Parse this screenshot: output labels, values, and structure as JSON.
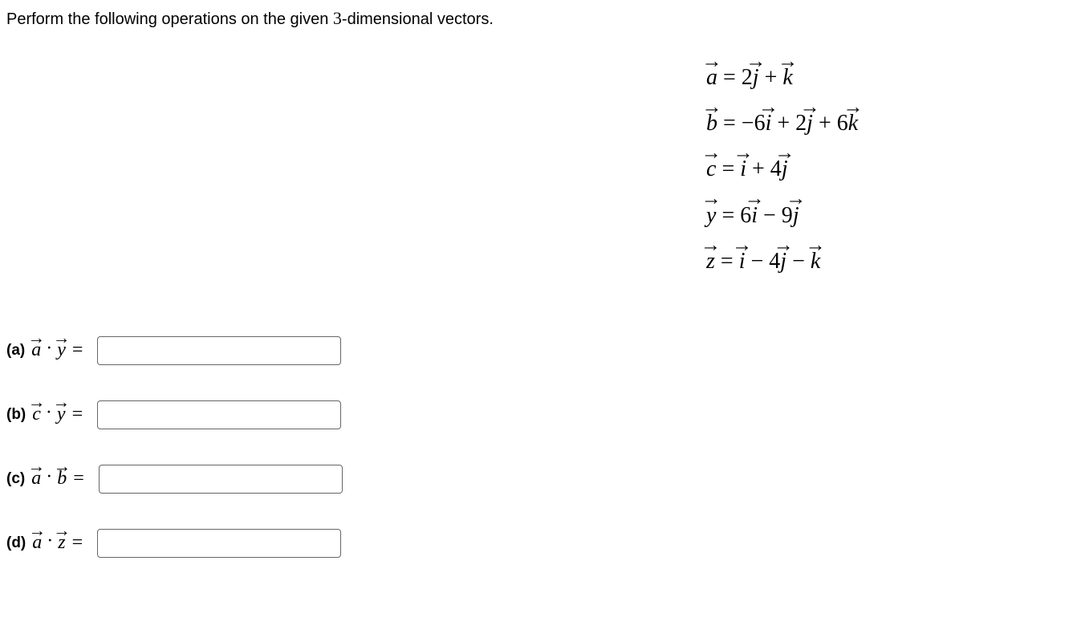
{
  "instruction": {
    "prefix": "Perform the following operations on the given ",
    "three": "3",
    "suffix": "-dimensional vectors."
  },
  "vectors": {
    "a": {
      "sym": "a",
      "rhs_before": " = 2",
      "j": "j",
      "mid1": " + ",
      "k": "k",
      "rhs_after": ""
    },
    "b": {
      "sym": "b",
      "p1": " = −6",
      "i": "i",
      "p2": " + 2",
      "j": "j",
      "p3": " + 6",
      "k": "k"
    },
    "c": {
      "sym": "c",
      "p1": " = ",
      "i": "i",
      "p2": " + 4",
      "j": "j"
    },
    "y": {
      "sym": "y",
      "p1": " = 6",
      "i": "i",
      "p2": " − 9",
      "j": "j"
    },
    "z": {
      "sym": "z",
      "p1": " = ",
      "i": "i",
      "p2": " − 4",
      "j": "j",
      "p3": " − ",
      "k": "k"
    }
  },
  "questions": {
    "a": {
      "part": "(a)",
      "v1": "a",
      "v2": "y",
      "value": ""
    },
    "b": {
      "part": "(b)",
      "v1": "c",
      "v2": "y",
      "value": ""
    },
    "c": {
      "part": "(c)",
      "v1": "a",
      "v2": "b",
      "value": ""
    },
    "d": {
      "part": "(d)",
      "v1": "a",
      "v2": "z",
      "value": ""
    }
  },
  "symbols": {
    "dot": "·",
    "eq": "="
  }
}
